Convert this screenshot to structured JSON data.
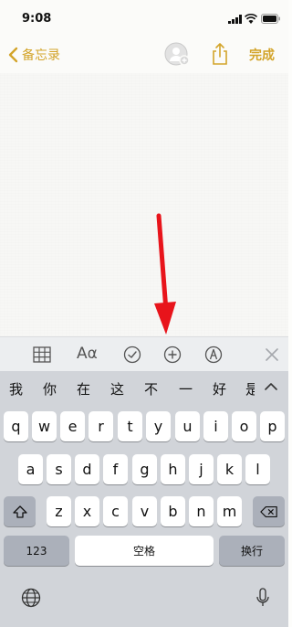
{
  "status_bar": {
    "time": "9:08"
  },
  "nav": {
    "back_label": "备忘录",
    "done_label": "完成"
  },
  "colors": {
    "accent": "#d3a42a",
    "annotation": "#e8141b"
  },
  "toolbar": {
    "text_format_label": "Aα"
  },
  "keyboard": {
    "candidates": [
      "我",
      "你",
      "在",
      "这",
      "不",
      "一",
      "好",
      "是"
    ],
    "row1": [
      "q",
      "w",
      "e",
      "r",
      "t",
      "y",
      "u",
      "i",
      "o",
      "p"
    ],
    "row2": [
      "a",
      "s",
      "d",
      "f",
      "g",
      "h",
      "j",
      "k",
      "l"
    ],
    "row3": [
      "z",
      "x",
      "c",
      "v",
      "b",
      "n",
      "m"
    ],
    "numbers_label": "123",
    "space_label": "空格",
    "return_label": "换行"
  }
}
